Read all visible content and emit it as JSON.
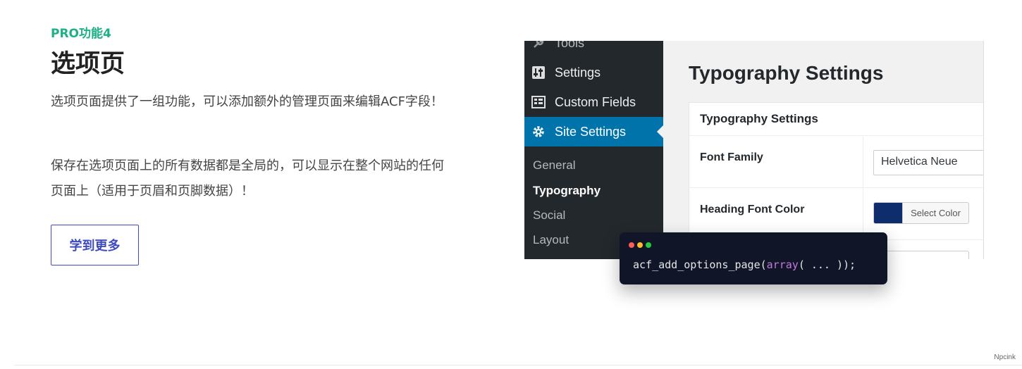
{
  "section": {
    "eyebrow": "PRO功能4",
    "title": "选项页",
    "paragraph1": "选项页面提供了一组功能，可以添加额外的管理页面来编辑ACF字段！",
    "paragraph2": "保存在选项页面上的所有数据都是全局的，可以显示在整个网站的任何页面上（适用于页眉和页脚数据）！",
    "button_label": "学到更多"
  },
  "screenshot": {
    "sidebar": {
      "items": [
        {
          "label": "Tools",
          "icon": "wrench-icon"
        },
        {
          "label": "Settings",
          "icon": "sliders-icon"
        },
        {
          "label": "Custom Fields",
          "icon": "grid-icon"
        },
        {
          "label": "Site Settings",
          "icon": "gear-icon"
        }
      ],
      "submenu": [
        "General",
        "Typography",
        "Social",
        "Layout"
      ]
    },
    "page_title": "Typography Settings",
    "box_title": "Typography Settings",
    "fields": [
      {
        "label": "Font Family",
        "value": "Helvetica Neue"
      },
      {
        "label": "Heading Font Color",
        "button": "Select Color",
        "color": "#0d2d6c"
      }
    ]
  },
  "code": {
    "fn": "acf_add_options_page",
    "arg_kw": "array",
    "tail": "( ... ));",
    "open": "("
  },
  "colors": {
    "accent_green": "#1db088",
    "accent_blue": "#3e4bbf",
    "wp_blue": "#0073aa",
    "wp_dark": "#23282d"
  },
  "watermark": "Npcink"
}
